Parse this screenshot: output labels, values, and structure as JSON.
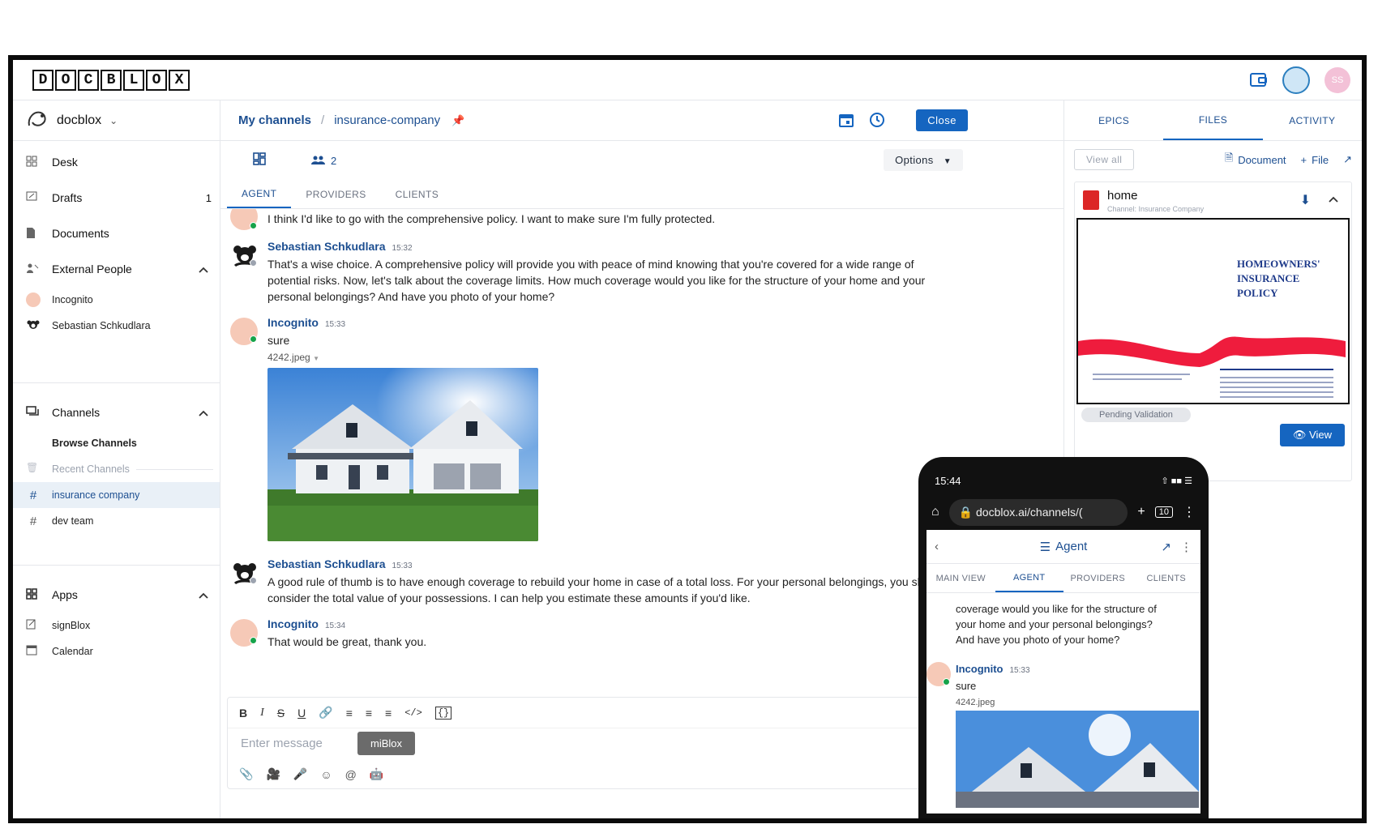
{
  "app": {
    "logo_letters": [
      "D",
      "O",
      "C",
      "B",
      "L",
      "O",
      "X"
    ],
    "user_initials": "SS",
    "brand_color": "#1565c0"
  },
  "sidebar": {
    "workspace": "docblox",
    "nav": [
      {
        "label": "Desk",
        "icon": "desk-icon"
      },
      {
        "label": "Drafts",
        "badge": "1",
        "icon": "drafts-icon"
      },
      {
        "label": "Documents",
        "icon": "document-icon"
      }
    ],
    "external_people_title": "External People",
    "external_people": [
      "Incognito",
      "Sebastian Schkudlara"
    ],
    "channels_title": "Channels",
    "browse_channels": "Browse Channels",
    "recent_channels": "Recent Channels",
    "channels": [
      "insurance company",
      "dev team"
    ],
    "apps_title": "Apps",
    "apps": [
      "signBlox",
      "Calendar"
    ]
  },
  "main": {
    "breadcrumb_root": "My channels",
    "breadcrumb_channel": "insurance-company",
    "close_label": "Close",
    "members_count": "2",
    "options_label": "Options",
    "tabs": [
      "AGENT",
      "PROVIDERS",
      "CLIENTS"
    ],
    "messages": [
      {
        "author": "Incognito",
        "time": "",
        "text": "I think I'd like to go with the comprehensive policy. I want to make sure I'm fully protected."
      },
      {
        "author": "Sebastian Schkudlara",
        "time": "15:32",
        "text": "That's a wise choice. A comprehensive policy will provide you with peace of mind knowing that you're covered for a wide range of potential risks. Now, let's talk about the coverage limits. How much coverage would you like for the structure of your home and your personal belongings? And have you photo of your home?"
      },
      {
        "author": "Incognito",
        "time": "15:33",
        "text": "sure",
        "attachment": "4242.jpeg"
      },
      {
        "author": "Sebastian Schkudlara",
        "time": "15:33",
        "text": "A good rule of thumb is to have enough coverage to rebuild your home in case of a total loss. For your personal belongings, you should consider the total value of your possessions. I can help you estimate these amounts if you'd like."
      },
      {
        "author": "Incognito",
        "time": "15:34",
        "text": "That would be great, thank you."
      }
    ],
    "composer": {
      "placeholder": "Enter message",
      "miblox_label": "miBlox"
    }
  },
  "right_panel": {
    "tabs": [
      "EPICS",
      "FILES",
      "ACTIVITY"
    ],
    "view_all": "View all",
    "document_btn": "Document",
    "file_btn": "File",
    "file": {
      "title": "home",
      "subtitle": "Channel: Insurance Company",
      "preview_title": "HOMEOWNERS' INSURANCE POLICY",
      "pending_label": "Pending Validation",
      "view_label": "View"
    }
  },
  "phone": {
    "time": "15:44",
    "url": "docblox.ai/channels/(",
    "tab_count": "10",
    "header": "Agent",
    "tabs": [
      "MAIN VIEW",
      "AGENT",
      "PROVIDERS",
      "CLIENTS"
    ],
    "text": "coverage would you like for the structure of your home and your personal belongings? And have you photo of your home?",
    "msg_author": "Incognito",
    "msg_time": "15:33",
    "msg_text": "sure",
    "attachment": "4242.jpeg"
  }
}
